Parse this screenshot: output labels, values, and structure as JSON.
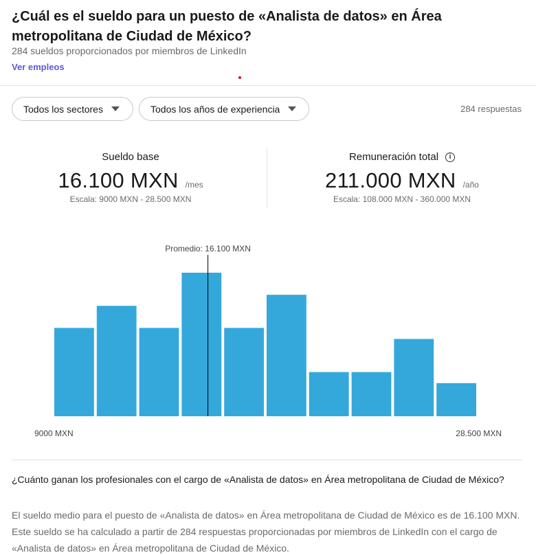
{
  "header": {
    "title": "¿Cuál es el sueldo para un puesto de «Analista de datos» en Área metropolitana de Ciudad de México?",
    "subtitle": "284 sueldos proporcionados por miembros de LinkedIn",
    "link_label": "Ver empleos"
  },
  "filters": {
    "sector_label": "Todos los sectores",
    "experience_label": "Todos los años de experiencia",
    "responses": "284 respuestas"
  },
  "stats": {
    "base": {
      "label": "Sueldo base",
      "value": "16.100 MXN",
      "unit": "/mes",
      "range": "Escala: 9000 MXN - 28.500 MXN"
    },
    "total": {
      "label": "Remuneración total",
      "value": "211.000 MXN",
      "unit": "/año",
      "range": "Escala: 108.000 MXN - 360.000 MXN"
    }
  },
  "chart_data": {
    "type": "bar",
    "bar_color": "#34a8db",
    "relative_values": [
      8,
      10,
      8,
      13,
      8,
      11,
      4,
      4,
      7,
      3
    ],
    "min_label": "9000 MXN",
    "max_label": "28.500 MXN",
    "xlim": [
      9000,
      28500
    ],
    "average_label": "Promedio: 16.100 MXN",
    "average_value": 16100
  },
  "faq": {
    "question": "¿Cuánto ganan los profesionales con el cargo de «Analista de datos» en Área metropolitana de Ciudad de México?",
    "answer": "El sueldo medio para el puesto de «Analista de datos» en Área metropolitana de Ciudad de México es de 16.100 MXN. Este sueldo se ha calculado a partir de 284 respuestas proporcionadas por miembros de LinkedIn con el cargo de «Analista de datos» en Área metropolitana de Ciudad de México."
  }
}
